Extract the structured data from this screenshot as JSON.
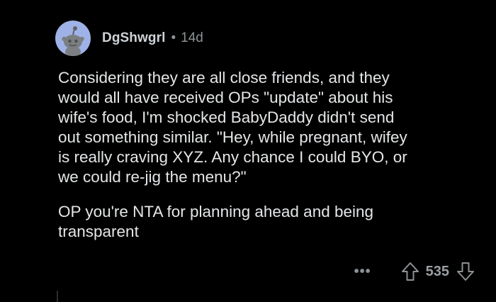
{
  "comment": {
    "author": "DgShwgrl",
    "separator": "•",
    "age": "14d",
    "paragraphs": [
      "Considering they are all close friends, and they\nwould all have received OPs \"update\" about his\nwife's food, I'm shocked BabyDaddy didn't send\nout something similar. \"Hey, while pregnant, wifey\nis really craving XYZ. Any chance I could BYO, or\nwe could re-jig the menu?\"",
      "OP you're NTA for planning ahead and being\ntransparent"
    ],
    "actions": {
      "more_label": "•••",
      "score": "535",
      "upvote_icon": "arrow-up-outline-icon",
      "downvote_icon": "arrow-down-outline-icon",
      "more_icon": "ellipsis-icon"
    }
  },
  "colors": {
    "background": "#000000",
    "avatar_bg": "#9fb2e8",
    "text_primary": "#e4e6e8",
    "text_meta": "#8c9194"
  }
}
